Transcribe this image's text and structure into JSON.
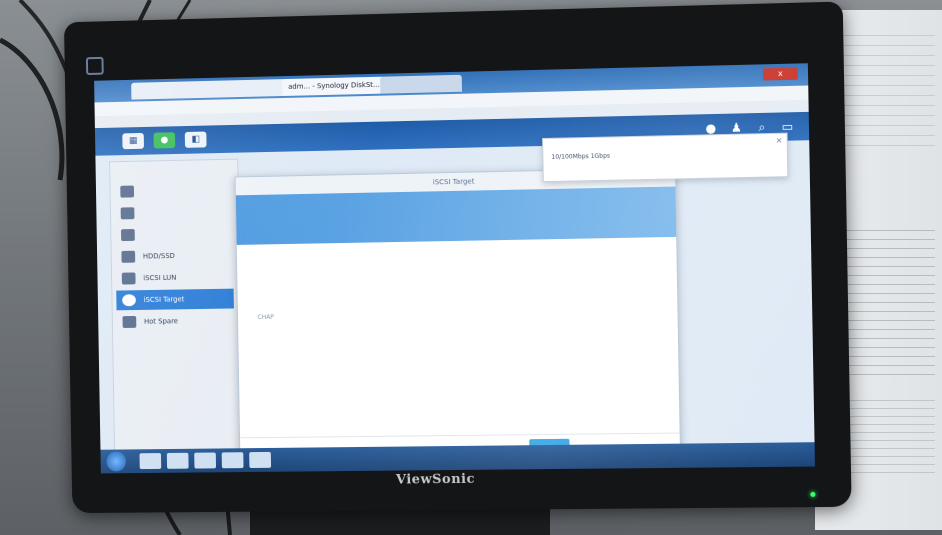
{
  "browser": {
    "tabs": [
      "adm... - Synology DiskSt...",
      "",
      ""
    ],
    "address": "",
    "bookmarks": "",
    "window_close": "x"
  },
  "dsm": {
    "nav_items": [
      "",
      "",
      "",
      "HDD/SSD",
      "iSCSI LUN",
      "iSCSI Target",
      "Hot Spare"
    ],
    "active_index": 5
  },
  "wizard": {
    "title": "iSCSI Target",
    "heading": "",
    "subheading": "",
    "rows": [
      {
        "k": "",
        "v": ""
      },
      {
        "k": "",
        "v": ""
      },
      {
        "k": "",
        "v": ""
      },
      {
        "k": "",
        "v": ""
      },
      {
        "k": "CHAP",
        "v": ""
      },
      {
        "k": "",
        "v": ""
      },
      {
        "k": "",
        "v": ""
      },
      {
        "k": "",
        "v": ""
      },
      {
        "k": "",
        "v": ""
      }
    ],
    "back_label": "",
    "apply_label": "",
    "cancel_label": ""
  },
  "notification": {
    "title": "",
    "body": "10/100Mbps 1Gbps",
    "close": "×"
  },
  "taskbar": {
    "icons": [
      "",
      "",
      "",
      "",
      ""
    ],
    "clock": ""
  },
  "monitor": {
    "brand": "ViewSonic"
  },
  "paper": {
    "title": ""
  }
}
